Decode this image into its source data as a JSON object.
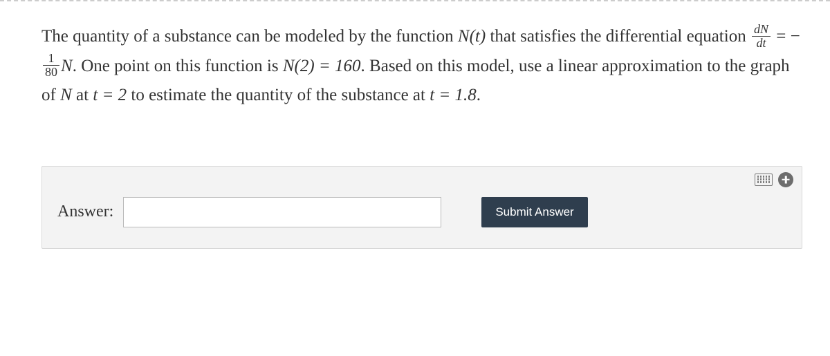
{
  "question": {
    "p1a": "The quantity of a substance can be modeled by the function ",
    "Nt": "N(t)",
    "p1b": " that satisfies the differential equation ",
    "frac1_num": "dN",
    "frac1_den": "dt",
    "eq1_mid": " = −",
    "frac2_num": "1",
    "frac2_den": "80",
    "eq1_tail": "N",
    "p2a": ". One point on this function is ",
    "N2": "N(2) = 160",
    "p2b": ". Based on this model, use a linear approximation to the graph of ",
    "Nvar": "N",
    "p3a": " at ",
    "t2": "t = 2",
    "p3b": " to estimate the quantity of the substance at ",
    "t18": "t = 1.8",
    "p3c": "."
  },
  "answer": {
    "label": "Answer:",
    "value": "",
    "placeholder": ""
  },
  "buttons": {
    "submit": "Submit Answer"
  },
  "icons": {
    "keyboard": "keyboard-icon",
    "add": "plus-icon"
  }
}
